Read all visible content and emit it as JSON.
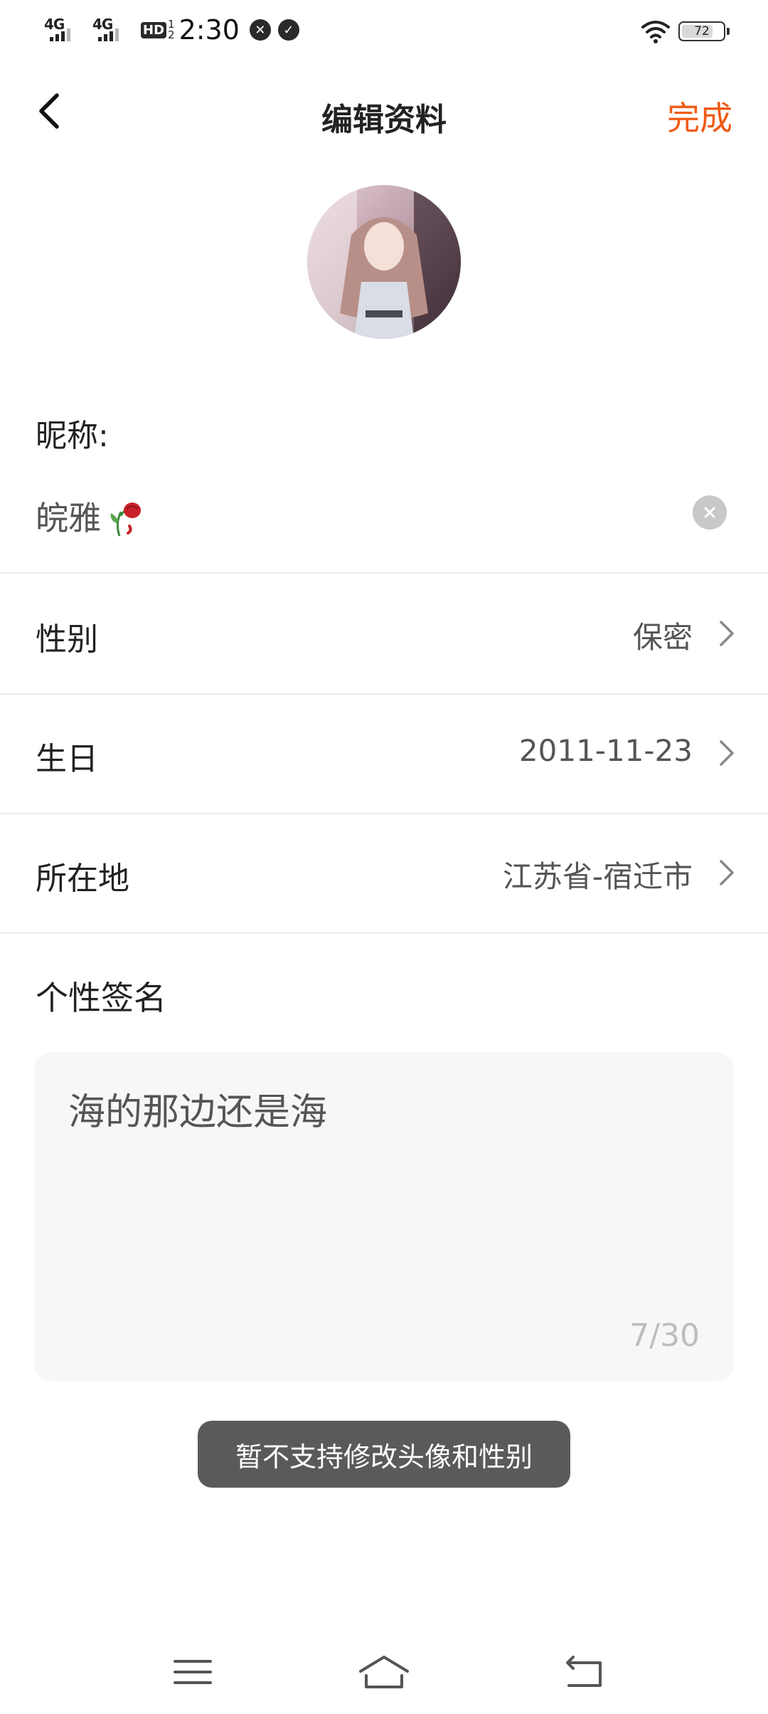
{
  "status_bar": {
    "net1": "4G",
    "net2": "4G",
    "hd": "HD",
    "hd_sup": "1",
    "hd_sub": "2",
    "time": "2:30",
    "battery": "72"
  },
  "header": {
    "title": "编辑资料",
    "done": "完成"
  },
  "nickname": {
    "label": "昵称:",
    "value": "皖雅"
  },
  "rows": [
    {
      "label": "性别",
      "value": "保密"
    },
    {
      "label": "生日",
      "value": "2011-11-23"
    },
    {
      "label": "所在地",
      "value": "江苏省-宿迁市"
    }
  ],
  "signature": {
    "label": "个性签名",
    "text": "海的那边还是海",
    "count": "7/30"
  },
  "toast": "暂不支持修改头像和性别",
  "colors": {
    "accent": "#f05a14",
    "toast_bg": "#5a5a5a",
    "field_bg": "#f7f7f7"
  },
  "icons": [
    "back-arrow-icon",
    "rose-emoji-icon",
    "clear-icon",
    "chevron-right-icon",
    "menu-icon",
    "home-icon",
    "back-nav-icon",
    "wifi-icon",
    "battery-icon"
  ]
}
